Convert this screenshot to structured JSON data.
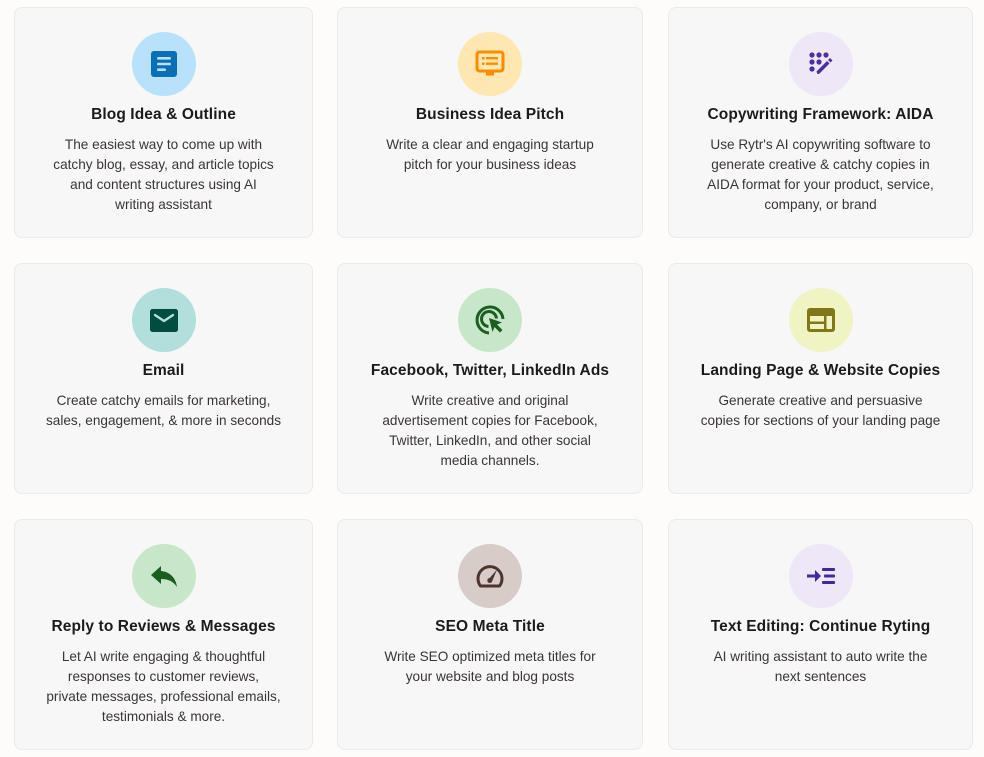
{
  "cards": [
    {
      "title": "Blog Idea & Outline",
      "description": "The easiest way to come up with\ncatchy blog, essay, and article topics\nand content structures using AI\nwriting assistant",
      "icon": "document-lines-icon",
      "icon_bg": "#b8e2fb",
      "icon_color": "#0a6fb5"
    },
    {
      "title": "Business Idea Pitch",
      "description": "Write a clear and engaging startup\npitch for your business ideas",
      "icon": "presentation-screen-icon",
      "icon_bg": "#fee7b0",
      "icon_color": "#fb8c00"
    },
    {
      "title": "Copywriting Framework: AIDA",
      "description": "Use Rytr's AI copywriting software to\ngenerate creative & catchy copies in\nAIDA format for your product, service,\ncompany, or brand",
      "icon": "dots-pencil-icon",
      "icon_bg": "#ede7f7",
      "icon_color": "#4d2fa0"
    },
    {
      "title": "Email",
      "description": "Create catchy emails for marketing,\nsales, engagement, & more in seconds",
      "icon": "envelope-icon",
      "icon_bg": "#b2dfdb",
      "icon_color": "#004d40"
    },
    {
      "title": "Facebook, Twitter, LinkedIn Ads",
      "description": "Write creative and original\nadvertisement copies for Facebook,\nTwitter, LinkedIn, and other social\nmedia channels.",
      "icon": "target-cursor-icon",
      "icon_bg": "#c8e6c9",
      "icon_color": "#1b5e20"
    },
    {
      "title": "Landing Page & Website Copies",
      "description": "Generate creative and persuasive\ncopies for sections of your landing page",
      "icon": "web-layout-icon",
      "icon_bg": "#f0f4c3",
      "icon_color": "#827717"
    },
    {
      "title": "Reply to Reviews & Messages",
      "description": "Let AI write engaging & thoughtful\nresponses to customer reviews,\nprivate messages, professional emails,\ntestimonials & more.",
      "icon": "reply-arrow-icon",
      "icon_bg": "#c8e6c9",
      "icon_color": "#1b5e20"
    },
    {
      "title": "SEO Meta Title",
      "description": "Write SEO optimized meta titles for\nyour website and blog posts",
      "icon": "speedometer-icon",
      "icon_bg": "#d7ccc8",
      "icon_color": "#4e342e"
    },
    {
      "title": "Text Editing: Continue Ryting",
      "description": "AI writing assistant to auto write the\nnext sentences",
      "icon": "arrow-indent-icon",
      "icon_bg": "#ede7f7",
      "icon_color": "#4527a0"
    }
  ]
}
